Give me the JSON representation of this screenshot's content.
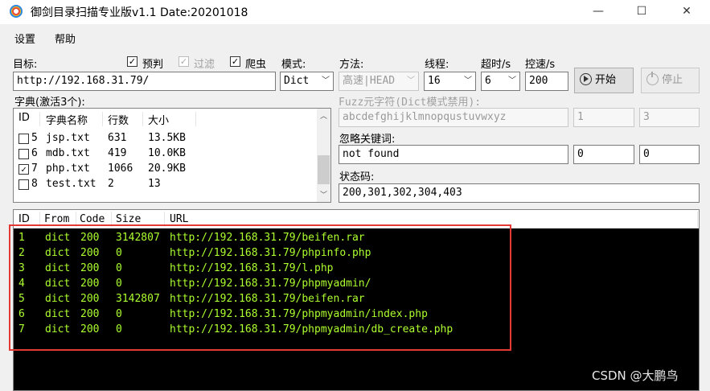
{
  "window": {
    "title": "御剑目录扫描专业版v1.1 Date:20201018",
    "minimize": "—",
    "maximize": "☐",
    "close": "✕"
  },
  "menu": {
    "settings": "设置",
    "help": "帮助"
  },
  "target": {
    "label": "目标:",
    "value": "http://192.168.31.79/"
  },
  "options": {
    "prejudge": {
      "label": "预判",
      "checked": true
    },
    "filter": {
      "label": "过滤",
      "checked": true,
      "disabled": true
    },
    "crawler": {
      "label": "爬虫",
      "checked": true
    }
  },
  "mode": {
    "label": "模式:",
    "value": "Dict"
  },
  "method": {
    "label": "方法:",
    "value": "高速|HEAD"
  },
  "threads": {
    "label": "线程:",
    "value": "16"
  },
  "timeout": {
    "label": "超时/s",
    "value": "6"
  },
  "speed": {
    "label": "控速/s",
    "value": "200"
  },
  "buttons": {
    "start": "开始",
    "stop": "停止"
  },
  "dict": {
    "label": "字典(激活3个):",
    "headers": {
      "id": "ID",
      "name": "字典名称",
      "lines": "行数",
      "size": "大小"
    },
    "rows": [
      {
        "id": "5",
        "name": "jsp.txt",
        "lines": "631",
        "size": "13.5KB",
        "checked": false
      },
      {
        "id": "6",
        "name": "mdb.txt",
        "lines": "419",
        "size": "10.0KB",
        "checked": false
      },
      {
        "id": "7",
        "name": "php.txt",
        "lines": "1066",
        "size": "20.9KB",
        "checked": true
      },
      {
        "id": "8",
        "name": "test.txt",
        "lines": "2",
        "size": "13",
        "checked": false
      }
    ]
  },
  "fuzz": {
    "label": "Fuzz元字符(Dict模式禁用):",
    "chars": "abcdefghijklmnopqustuvwxyz",
    "min": "1",
    "max": "3"
  },
  "ignore": {
    "label": "忽略关键词:",
    "value": "not found",
    "a": "0",
    "b": "0"
  },
  "status": {
    "label": "状态码:",
    "value": "200,301,302,304,403"
  },
  "results": {
    "headers": {
      "id": "ID",
      "from": "From",
      "code": "Code",
      "size": "Size",
      "url": "URL"
    },
    "rows": [
      {
        "id": "1",
        "from": "dict",
        "code": "200",
        "size": "3142807",
        "url": "http://192.168.31.79/beifen.rar"
      },
      {
        "id": "2",
        "from": "dict",
        "code": "200",
        "size": "0",
        "url": "http://192.168.31.79/phpinfo.php"
      },
      {
        "id": "3",
        "from": "dict",
        "code": "200",
        "size": "0",
        "url": "http://192.168.31.79/l.php"
      },
      {
        "id": "4",
        "from": "dict",
        "code": "200",
        "size": "0",
        "url": "http://192.168.31.79/phpmyadmin/"
      },
      {
        "id": "5",
        "from": "dict",
        "code": "200",
        "size": "3142807",
        "url": "http://192.168.31.79/beifen.rar"
      },
      {
        "id": "6",
        "from": "dict",
        "code": "200",
        "size": "0",
        "url": "http://192.168.31.79/phpmyadmin/index.php"
      },
      {
        "id": "7",
        "from": "dict",
        "code": "200",
        "size": "0",
        "url": "http://192.168.31.79/phpmyadmin/db_create.php"
      }
    ]
  },
  "watermark": "CSDN @大鹏鸟",
  "colors": {
    "result_text": "#adff2f",
    "highlight": "#e53935"
  }
}
